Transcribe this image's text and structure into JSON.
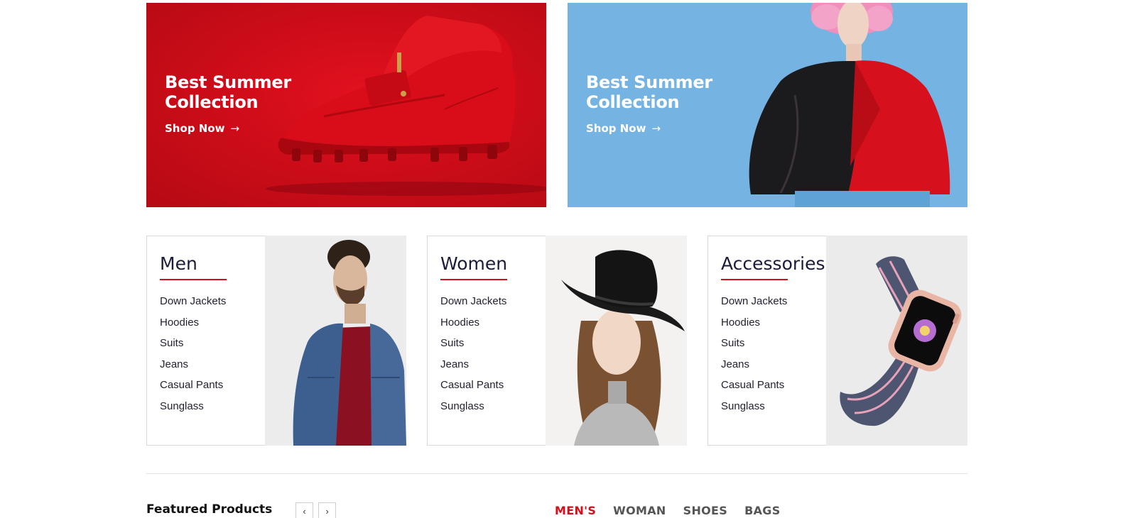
{
  "banners": [
    {
      "title": "Best Summer Collection",
      "cta": "Shop Now",
      "cta_icon": "arrow-right-icon",
      "background": "#c90c18"
    },
    {
      "title": "Best Summer Collection",
      "cta": "Shop Now",
      "cta_icon": "arrow-right-icon",
      "background": "#74b3e2"
    }
  ],
  "categories": [
    {
      "title": "Men",
      "items": [
        "Down Jackets",
        "Hoodies",
        "Suits",
        "Jeans",
        "Casual Pants",
        "Sunglass"
      ]
    },
    {
      "title": "Women",
      "items": [
        "Down Jackets",
        "Hoodies",
        "Suits",
        "Jeans",
        "Casual Pants",
        "Sunglass"
      ]
    },
    {
      "title": "Accessories",
      "items": [
        "Down Jackets",
        "Hoodies",
        "Suits",
        "Jeans",
        "Casual Pants",
        "Sunglass"
      ]
    }
  ],
  "featured": {
    "title": "Featured Products",
    "prev_icon": "chevron-left-icon",
    "next_icon": "chevron-right-icon",
    "tabs": [
      "MEN'S",
      "WOMAN",
      "SHOES",
      "BAGS"
    ],
    "active_tab": "MEN'S"
  },
  "colors": {
    "accent": "#d0111b",
    "text": "#1b1b3a"
  }
}
